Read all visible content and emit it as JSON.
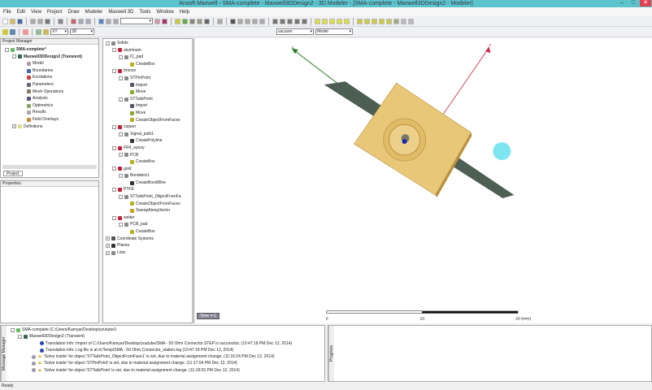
{
  "window": {
    "title": "Ansoft Maxwell  - SMA-complete - Maxwell3DDesign2 - 3D Modeler - [SMA-complete - Maxwell3DDesign2 - Modeler]"
  },
  "menu": [
    "File",
    "Edit",
    "View",
    "Project",
    "Draw",
    "Modeler",
    "Maxwell 3D",
    "Tools",
    "Window",
    "Help"
  ],
  "toolbar": {
    "plane": "XY",
    "view": "3D",
    "material": "vacuum",
    "mode": "Model"
  },
  "project_manager": {
    "title": "Project Manager",
    "project": "SMA-complete*",
    "design": "Maxwell3DDesign2 (Transient)",
    "items": [
      "Model",
      "Boundaries",
      "Excitations",
      "Parameters",
      "Mesh Operations",
      "Analysis",
      "Optimetrics",
      "Results",
      "Field Overlays"
    ],
    "definitions": "Definitions",
    "tab": "Project"
  },
  "properties": {
    "title": "Properties"
  },
  "model_tree": [
    {
      "t": "Solids",
      "l": 0,
      "c": "#888"
    },
    {
      "t": "aluminum",
      "l": 1,
      "c": "#c0203a"
    },
    {
      "t": "IC_pad",
      "l": 2,
      "c": "#888"
    },
    {
      "t": "CreateBox",
      "l": 3,
      "c": "#b8b020"
    },
    {
      "t": "bronze",
      "l": 1,
      "c": "#c0203a"
    },
    {
      "t": "STPinPoint",
      "l": 2,
      "c": "#888"
    },
    {
      "t": "Import",
      "l": 3,
      "c": "#556"
    },
    {
      "t": "Move",
      "l": 3,
      "c": "#8a3"
    },
    {
      "t": "STTailsPoint",
      "l": 2,
      "c": "#888"
    },
    {
      "t": "Import",
      "l": 3,
      "c": "#556"
    },
    {
      "t": "Move",
      "l": 3,
      "c": "#8a3"
    },
    {
      "t": "CreateObjectFromFaces",
      "l": 3,
      "c": "#b8b020"
    },
    {
      "t": "copper",
      "l": 1,
      "c": "#c0203a"
    },
    {
      "t": "Signal_path1",
      "l": 2,
      "c": "#888"
    },
    {
      "t": "CreatePolyline",
      "l": 3,
      "c": "#333"
    },
    {
      "t": "FR4_epoxy",
      "l": 1,
      "c": "#c0203a"
    },
    {
      "t": "PCB",
      "l": 2,
      "c": "#888"
    },
    {
      "t": "CreateBox",
      "l": 3,
      "c": "#b8b020"
    },
    {
      "t": "gold",
      "l": 1,
      "c": "#c0203a"
    },
    {
      "t": "Bondwire1",
      "l": 2,
      "c": "#888"
    },
    {
      "t": "CreateBondWire",
      "l": 3,
      "c": "#333"
    },
    {
      "t": "PTFE",
      "l": 1,
      "c": "#c0203a"
    },
    {
      "t": "STTailsPoint_ObjectFromFa",
      "l": 2,
      "c": "#888"
    },
    {
      "t": "CreateObjectFromFaces",
      "l": 3,
      "c": "#b8b020"
    },
    {
      "t": "SweepAlongVector",
      "l": 3,
      "c": "#c9a020"
    },
    {
      "t": "solder",
      "l": 1,
      "c": "#c0203a"
    },
    {
      "t": "PCB_pad",
      "l": 2,
      "c": "#888"
    },
    {
      "t": "CreateBox",
      "l": 3,
      "c": "#b8b020"
    },
    {
      "t": "Coordinate Systems",
      "l": 0,
      "c": "#555"
    },
    {
      "t": "Planes",
      "l": 0,
      "c": "#333"
    },
    {
      "t": "Lists",
      "l": 0,
      "c": "#888"
    }
  ],
  "viewport": {
    "axis_z": "z",
    "axis_y": "y",
    "time_label": "Time =-1",
    "scale": {
      "ticks": [
        "0",
        "10",
        "20 (mm)"
      ]
    },
    "colors": {
      "connector": "#e8c878",
      "strip": "#4d5e52",
      "axis_z": "#2a7a2a",
      "axis_y": "#d0203a"
    }
  },
  "messages": {
    "side_label": "Message Manager",
    "project": "SMA-complete (C:/Users/Kamyar/Desktop/youtube/)",
    "design": "Maxwell3DDesign2 (Transient)",
    "lines": [
      {
        "type": "info",
        "text": "Translation Info: Import of C:/Users/Kamyar/Desktop/youtube/SMA - 50 Ohm Connector.STEP is successful.  (10:47:18 PM  Dec 12, 2014)"
      },
      {
        "type": "info",
        "text": "Translation Info: Log file is at d:/Temp/SMA - 50 Ohm Connector_station.log (10:47:18 PM  Dec 12, 2014)"
      },
      {
        "type": "warn",
        "text": "'Solve inside' for object 'STTailsPoint_ObjectFromFace1' is set, due to material assignment change.  (11:16:24 PM  Dec 12, 2014)"
      },
      {
        "type": "warn",
        "text": "'Solve inside' for object 'STPinPoint' is set, due to material assignment change.  (11:17:04 PM  Dec 12, 2014)"
      },
      {
        "type": "warn",
        "text": "'Solve inside' for object 'STTailsPoint' is set, due to material assignment change.  (11:18:03 PM  Dec 12, 2014)"
      }
    ]
  },
  "progress": {
    "side_label": "Progress"
  },
  "status": "Ready"
}
